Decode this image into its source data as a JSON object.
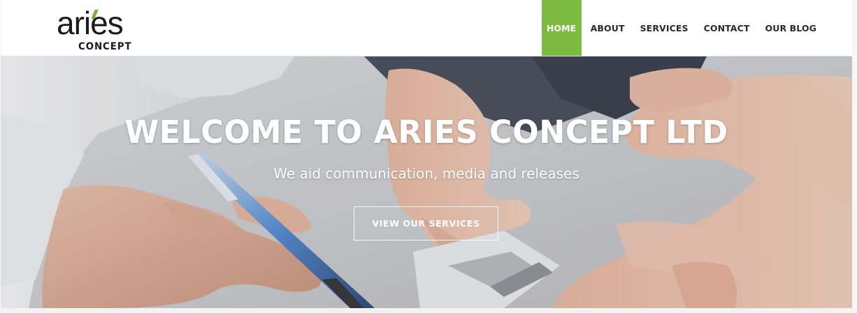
{
  "brand": {
    "logo_word": "aries",
    "logo_sub": "CONCEPT",
    "accent_color": "#7dba42"
  },
  "nav": {
    "items": [
      {
        "label": "HOME",
        "active": true
      },
      {
        "label": "ABOUT",
        "active": false
      },
      {
        "label": "SERVICES",
        "active": false
      },
      {
        "label": "CONTACT",
        "active": false
      },
      {
        "label": "OUR BLOG",
        "active": false
      }
    ]
  },
  "hero": {
    "title": "WELCOME TO ARIES CONCEPT LTD",
    "subtitle": "We aid communication, media and releases",
    "button_label": "VIEW OUR SERVICES"
  }
}
